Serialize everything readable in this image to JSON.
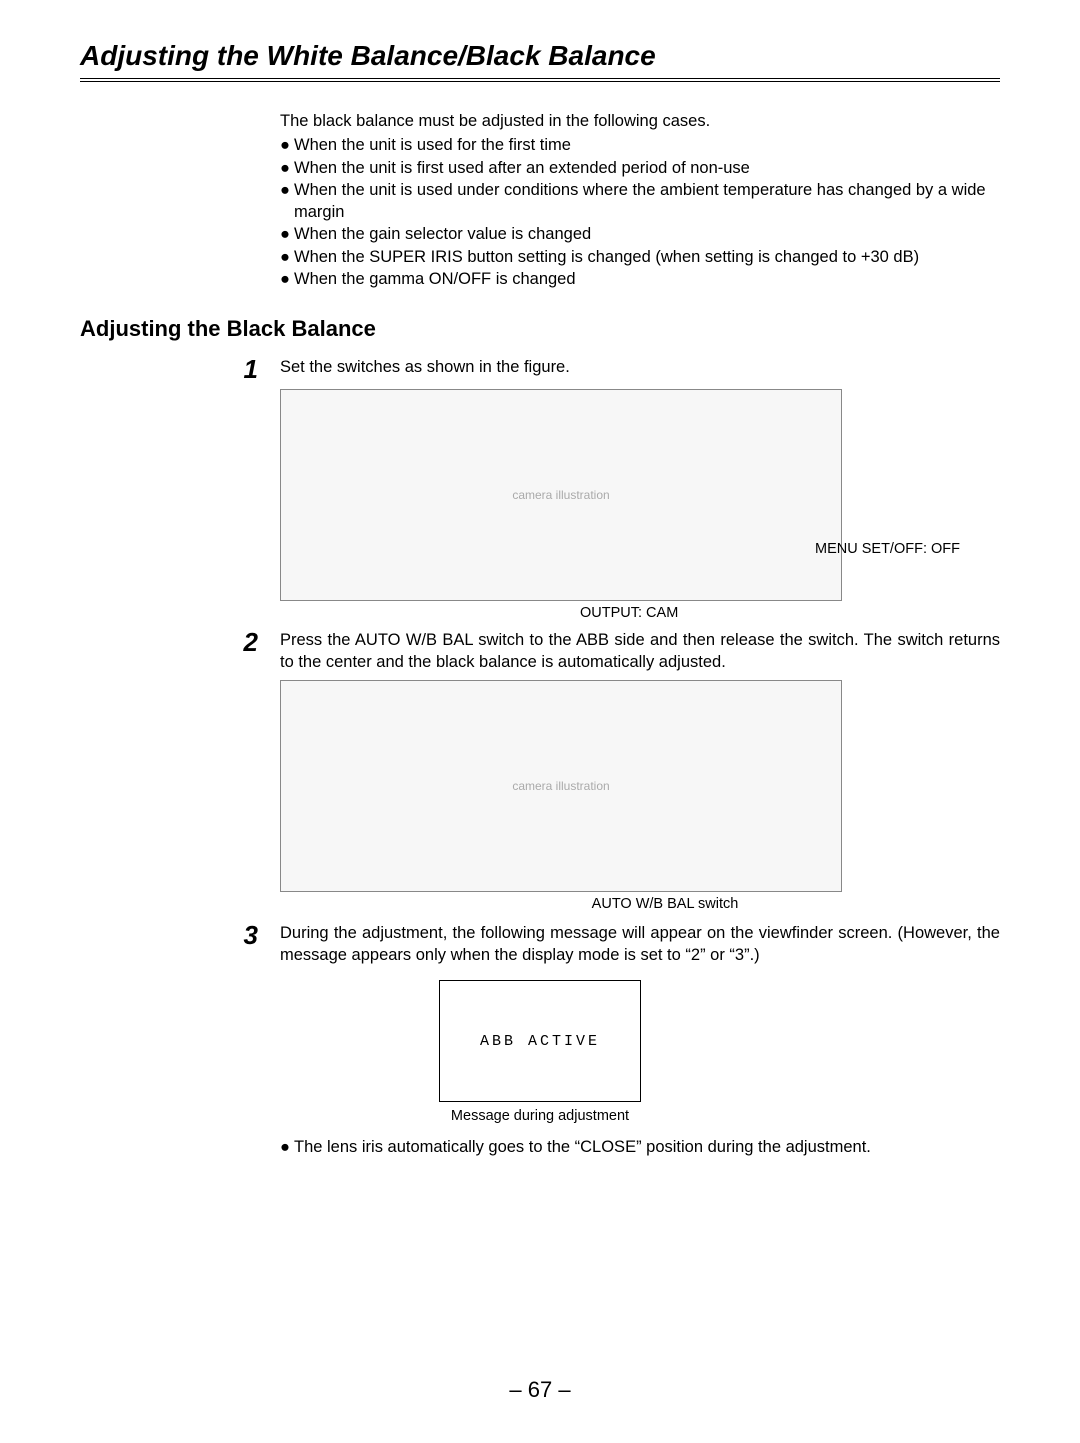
{
  "page_title": "Adjusting the White Balance/Black Balance",
  "intro_lead": "The black balance must be adjusted in the following cases.",
  "intro_bullets": [
    "When the unit is used for the first time",
    "When the unit is first used after an extended period of non-use",
    "When the unit is used under conditions where the ambient temperature has changed by a wide margin",
    "When the gain selector value is changed",
    "When the SUPER IRIS button setting is changed (when setting is changed to +30 dB)",
    "When the gamma ON/OFF is changed"
  ],
  "section_heading": "Adjusting the Black Balance",
  "steps": {
    "s1": {
      "num": "1",
      "text": "Set the switches as shown in the figure.",
      "fig_label_menu": "MENU SET/OFF: OFF",
      "fig_label_output": "OUTPUT: CAM"
    },
    "s2": {
      "num": "2",
      "text": "Press the AUTO W/B BAL switch to the ABB side and then release the switch. The switch returns to the center and the black balance is automatically adjusted.",
      "fig_label_auto": "AUTO W/B BAL switch"
    },
    "s3": {
      "num": "3",
      "text": "During the adjustment, the following message will appear on the viewfinder screen. (However, the message appears only when the display mode is set to “2” or “3”.)",
      "viewfinder_msg": "ABB ACTIVE",
      "viewfinder_caption": "Message during adjustment",
      "after_bullet": "The lens iris automatically goes to the “CLOSE” position during the adjustment."
    }
  },
  "page_number": "– 67 –",
  "fig_alt_1": "camera illustration",
  "fig_alt_2": "camera illustration"
}
